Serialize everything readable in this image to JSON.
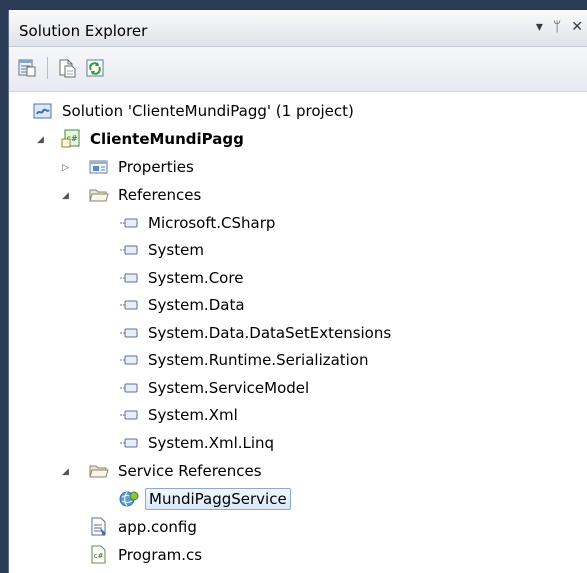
{
  "panel": {
    "title": "Solution Explorer",
    "controls": {
      "dropdown": "▾",
      "pin": "ᛘ",
      "close": "✕"
    }
  },
  "toolbar": {
    "buttons": [
      {
        "icon": "properties-window-icon"
      },
      {
        "icon": "show-all-files-icon"
      },
      {
        "icon": "refresh-icon"
      }
    ]
  },
  "tree": {
    "solution": "Solution 'ClienteMundiPagg' (1 project)",
    "project": "ClienteMundiPagg",
    "properties": "Properties",
    "references": {
      "label": "References",
      "items": [
        "Microsoft.CSharp",
        "System",
        "System.Core",
        "System.Data",
        "System.Data.DataSetExtensions",
        "System.Runtime.Serialization",
        "System.ServiceModel",
        "System.Xml",
        "System.Xml.Linq"
      ]
    },
    "service_references": {
      "label": "Service References",
      "items": [
        "MundiPaggService"
      ]
    },
    "files": [
      "app.config",
      "Program.cs"
    ]
  },
  "colors": {
    "selection_border": "#8ea9ce",
    "titlebar_bg": "#dfe2e8",
    "outer_bg": "#2b3c59"
  }
}
